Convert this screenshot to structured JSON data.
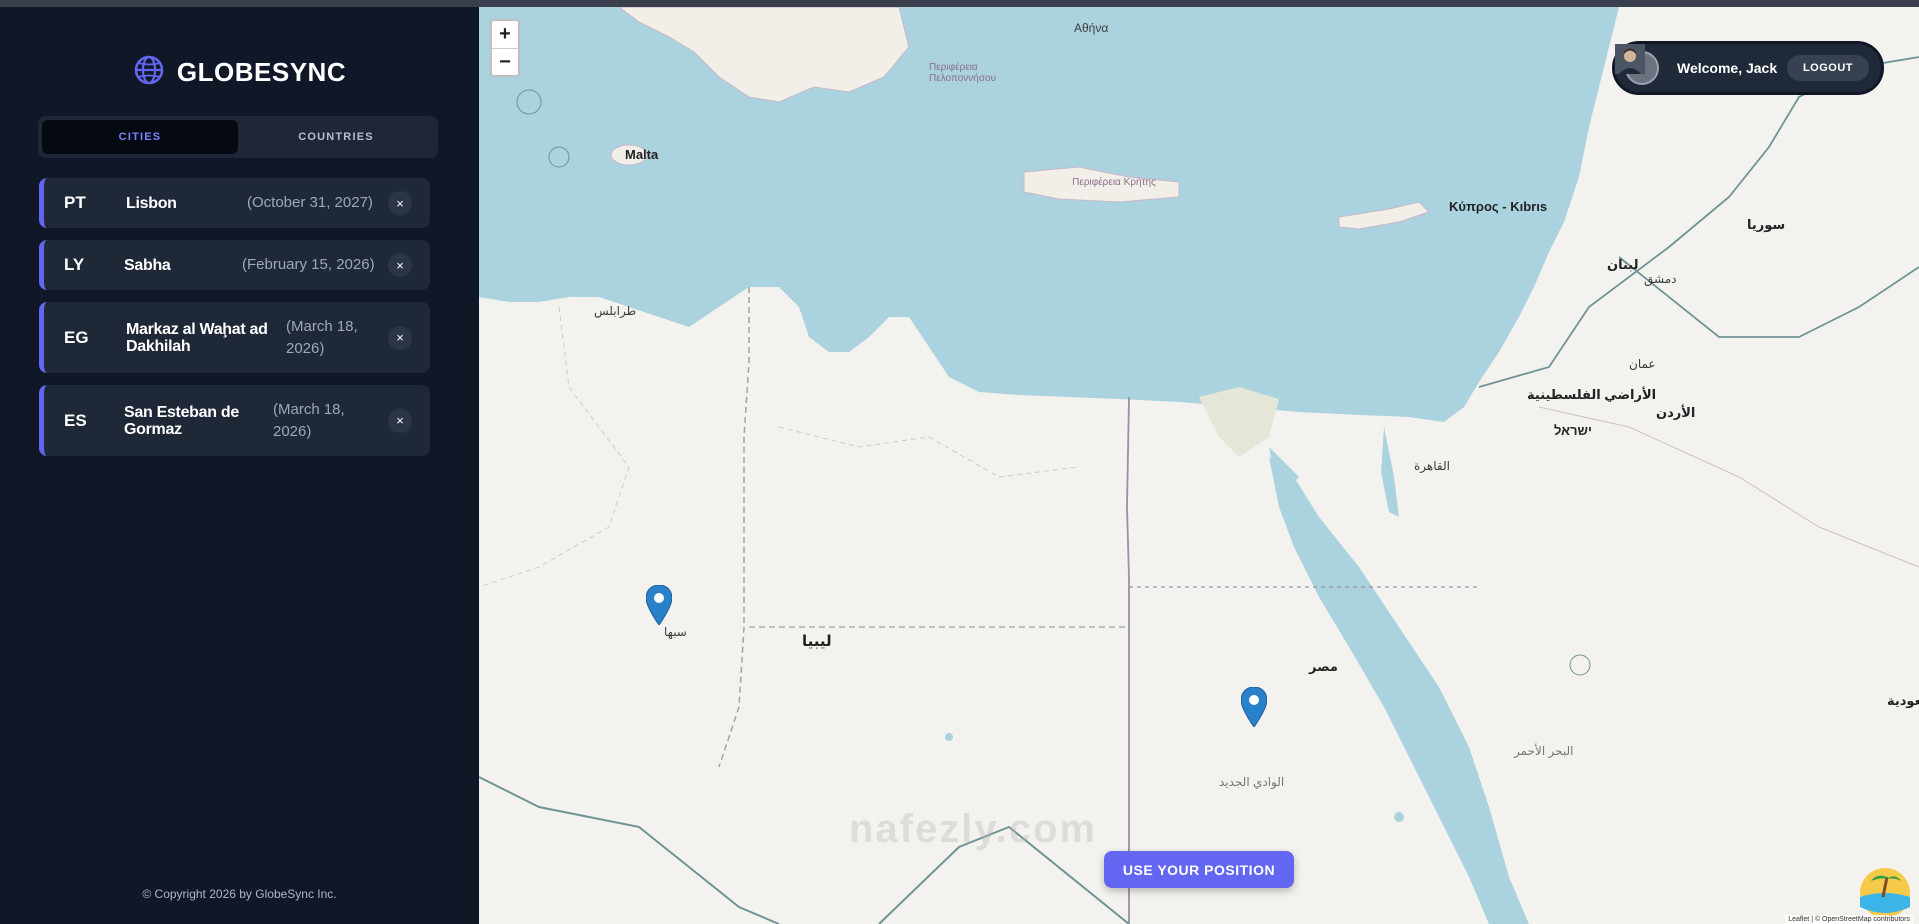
{
  "app": {
    "title": "GLOBESYNC",
    "copyright": "© Copyright 2026 by GlobeSync Inc."
  },
  "tabs": [
    {
      "label": "CITIES",
      "active": true
    },
    {
      "label": "COUNTRIES",
      "active": false
    }
  ],
  "cities": [
    {
      "code": "PT",
      "name": "Lisbon",
      "date": "(October 31, 2027)"
    },
    {
      "code": "LY",
      "name": "Sabha",
      "date": "(February 15, 2026)"
    },
    {
      "code": "EG",
      "name": "Markaz al Waḩat ad Dakhilah",
      "date": "(March 18, 2026)"
    },
    {
      "code": "ES",
      "name": "San Esteban de Gormaz",
      "date": "(March 18, 2026)"
    }
  ],
  "delete_glyph": "×",
  "map": {
    "zoom_in": "+",
    "zoom_out": "−",
    "use_position": "USE YOUR POSITION",
    "watermark": "nafezly.com",
    "attribution": "Leaflet | © OpenStreetMap contributors",
    "labels": {
      "malta": "Malta",
      "cyprus": "Κύπρος - Kıbrıs",
      "libya": "ليبيا",
      "egypt": "مصر",
      "syria": "سوريا",
      "lebanon": "لبنان",
      "jordan": "الأردن",
      "palestine": "الأراضي الفلسطينية",
      "israel": "ישראל",
      "athens": "Αθήνα",
      "tripoli": "طرابلس",
      "cairo": "القاهرة",
      "sabha": "سبها",
      "saudi": "السعودية",
      "crete": "Περιφέρεια Κρήτης",
      "peloponnese": "Περιφέρεια Πελοποννήσου",
      "damascus": "دمشق",
      "amman": "عمان",
      "new_valley": "الوادي الجديد",
      "red_sea": "البحر الأحمر"
    }
  },
  "user": {
    "welcome": "Welcome, Jack",
    "logout": "LOGOUT"
  },
  "colors": {
    "accent": "#6366f1",
    "sea": "#aad3df",
    "land": "#f4f2ee",
    "sidebar": "#101828",
    "marker": "#2a81cb"
  }
}
